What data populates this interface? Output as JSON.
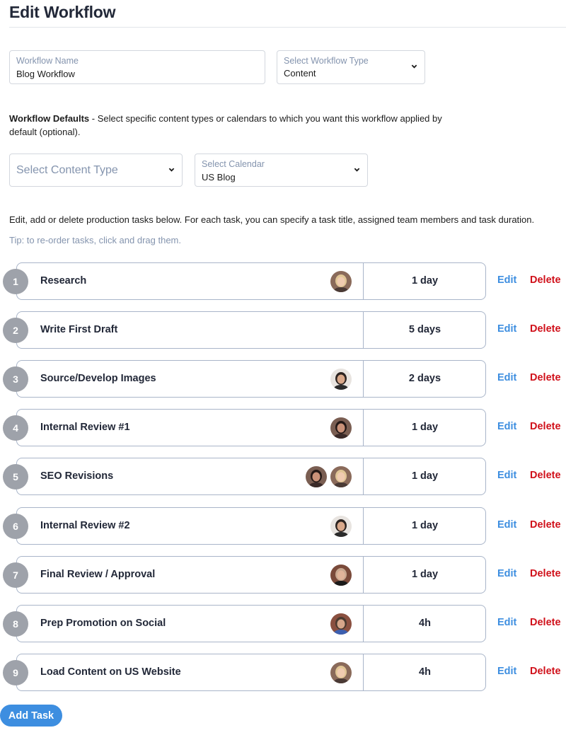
{
  "header": {
    "title": "Edit Workflow"
  },
  "form": {
    "workflow_name": {
      "label": "Workflow Name",
      "value": "Blog Workflow"
    },
    "workflow_type": {
      "label": "Select Workflow Type",
      "value": "Content"
    },
    "defaults": {
      "heading": "Workflow Defaults",
      "description": " - Select specific content types or calendars to which you want this workflow applied by default (optional)."
    },
    "content_type": {
      "placeholder": "Select Content Type"
    },
    "calendar": {
      "label": "Select Calendar",
      "value": "US Blog"
    }
  },
  "tasks_section": {
    "instructions": "Edit, add or delete production tasks below. For each task, you can specify a task title, assigned team members and task duration.",
    "tip": "Tip: to re-order tasks, click and drag them.",
    "edit_label": "Edit",
    "delete_label": "Delete",
    "add_task_label": "Add Task"
  },
  "tasks": [
    {
      "number": "1",
      "title": "Research",
      "duration": "1 day",
      "assignees": [
        "blonde-woman"
      ]
    },
    {
      "number": "2",
      "title": "Write First Draft",
      "duration": "5 days",
      "assignees": []
    },
    {
      "number": "3",
      "title": "Source/Develop Images",
      "duration": "2 days",
      "assignees": [
        "dark-haired-man"
      ]
    },
    {
      "number": "4",
      "title": "Internal Review #1",
      "duration": "1 day",
      "assignees": [
        "dark-haired-woman"
      ]
    },
    {
      "number": "5",
      "title": "SEO Revisions",
      "duration": "1 day",
      "assignees": [
        "dark-haired-woman",
        "blonde-woman"
      ]
    },
    {
      "number": "6",
      "title": "Internal Review #2",
      "duration": "1 day",
      "assignees": [
        "dark-haired-man"
      ]
    },
    {
      "number": "7",
      "title": "Final Review / Approval",
      "duration": "1 day",
      "assignees": [
        "bald-man"
      ]
    },
    {
      "number": "8",
      "title": "Prep Promotion on Social",
      "duration": "4h",
      "assignees": [
        "man-blue-shirt"
      ]
    },
    {
      "number": "9",
      "title": "Load Content on US Website",
      "duration": "4h",
      "assignees": [
        "blonde-woman"
      ]
    }
  ],
  "colors": {
    "accent_blue": "#3d8ee0",
    "delete_red": "#d0101a",
    "number_badge": "#9ea2aa",
    "muted_label": "#8494ae",
    "card_border": "#a9b5c9"
  }
}
